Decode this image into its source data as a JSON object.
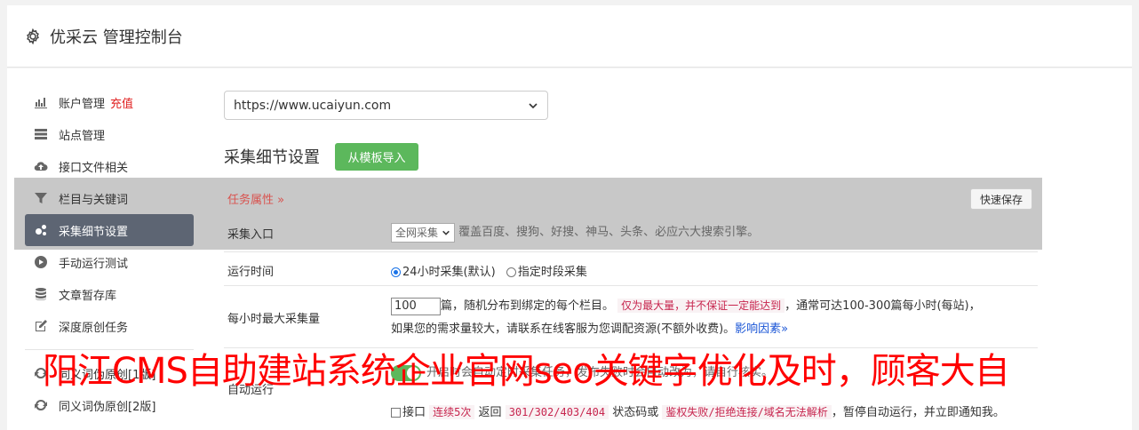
{
  "header": {
    "title": "优采云 管理控制台",
    "icon": "gear-icon"
  },
  "sidebar": {
    "items": [
      {
        "label": "账户管理",
        "badge": "充值",
        "icon": "bar-chart-icon"
      },
      {
        "label": "站点管理",
        "icon": "server-icon"
      },
      {
        "label": "接口文件相关",
        "icon": "cloud-upload-icon"
      },
      {
        "label": "栏目与关键词",
        "icon": "filter-icon"
      },
      {
        "label": "采集细节设置",
        "icon": "gears-icon",
        "active": true
      },
      {
        "label": "手动运行测试",
        "icon": "play-icon"
      },
      {
        "label": "文章暂存库",
        "icon": "database-icon"
      },
      {
        "label": "深度原创任务",
        "icon": "edit-icon"
      },
      {
        "label": "同义词伪原创[1版]",
        "icon": "refresh-icon"
      },
      {
        "label": "同义词伪原创[2版]",
        "icon": "refresh-icon"
      }
    ]
  },
  "main": {
    "site_select": "https://www.ucaiyun.com",
    "section_title": "采集细节设置",
    "template_button": "从模板导入",
    "task_label": "任务属性 »",
    "quick_save": "快速保存",
    "rows": {
      "entry": {
        "label": "采集入口",
        "select_value": "全网采集",
        "desc": "覆盖百度、搜狗、好搜、神马、头条、必应六大搜索引擎。"
      },
      "runtime": {
        "label": "运行时间",
        "option1": "24小时采集(默认)",
        "option2": "指定时段采集"
      },
      "max": {
        "label": "每小时最大采集量",
        "value": "100",
        "text1": "篇，随机分布到绑定的每个栏目。",
        "highlight": "仅为最大量，并不保证一定能达到",
        "text2": "，通常可达100-300篇每小时(每站)，",
        "text3": "如果您的需求量较大，请联系在线客服为您调配资源(不额外收费)。",
        "link": "影响因素"
      },
      "auto": {
        "label": "自动运行",
        "toggle_text": "开启时会自动定时采集任务，发布失败时会自动改为",
        "text_tail": "，请自行核实。"
      },
      "stop": {
        "check_label": "接口",
        "hl1": "连续5次",
        "text1": "返回",
        "hl2": "301/302/403/404",
        "text2": "状态码或",
        "hl3": "鉴权失败/拒绝连接/域名无法解析",
        "text3": "，暂停自动运行，并立即通知我。"
      }
    }
  },
  "overlay": {
    "text": "阳江CMS自助建站系统企业官网seo关键字优化及时，顾客大自"
  }
}
